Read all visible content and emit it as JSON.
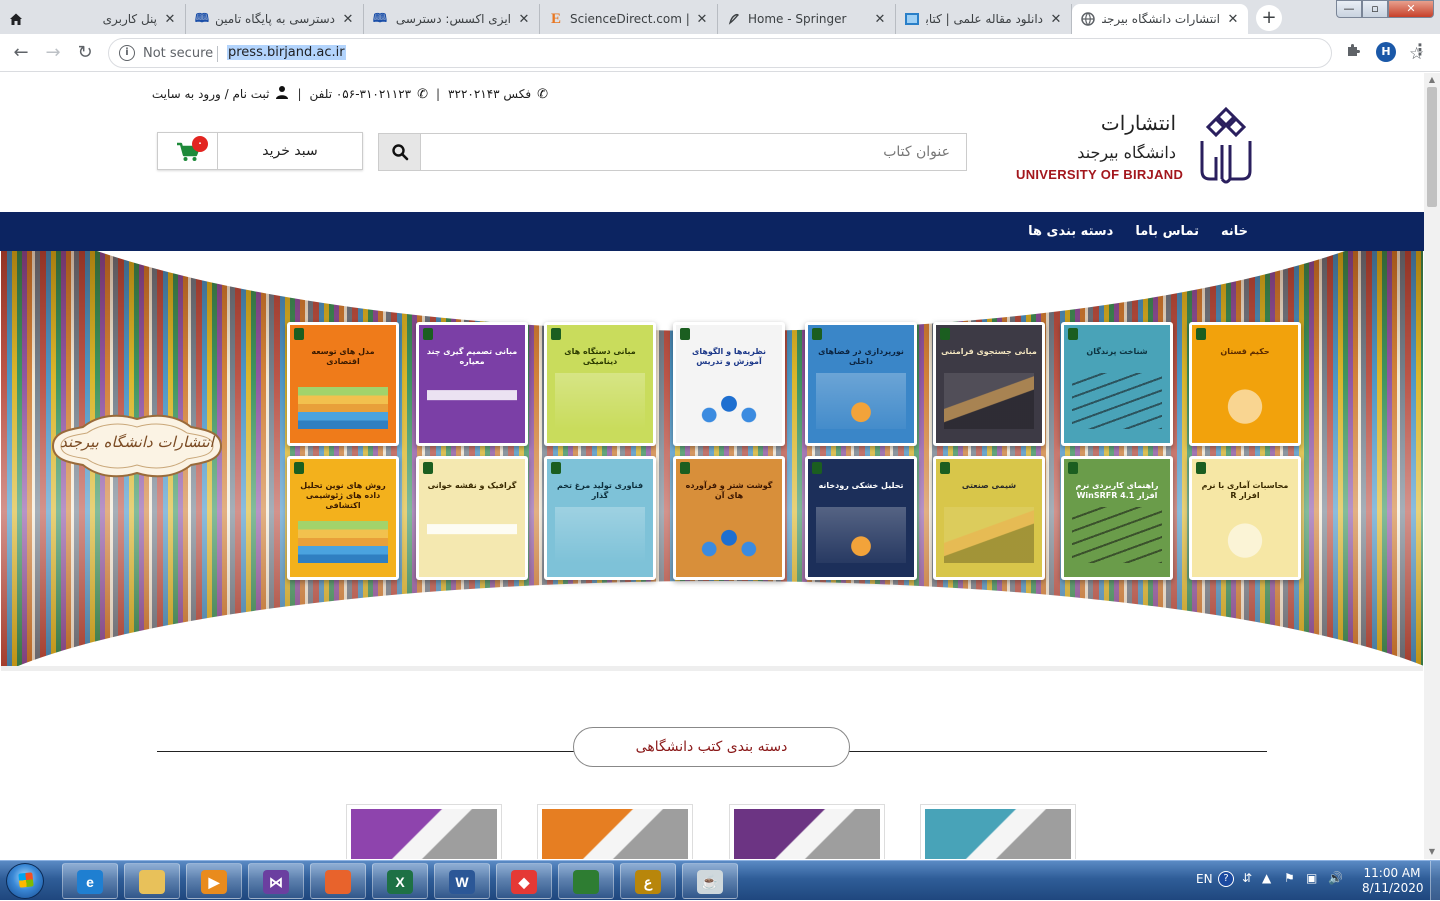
{
  "browser": {
    "tabs": [
      {
        "title": "پنل کاربری",
        "favicon": "home-icon"
      },
      {
        "title": "دسترسی به پایگاه تامین منابع",
        "favicon": "book-icon"
      },
      {
        "title": "ایزی اکسس: دسترسی مستقیم",
        "favicon": "book-icon"
      },
      {
        "title": "ScienceDirect.com | Science",
        "favicon": "elsevier-icon"
      },
      {
        "title": "Home - Springer",
        "favicon": "springer-icon"
      },
      {
        "title": "دانلود مقاله علمی | کتابخانه",
        "favicon": "page-icon"
      },
      {
        "title": "انتشارات دانشگاه بیرجند -",
        "favicon": "globe-icon"
      }
    ],
    "new_tab": "+",
    "window_controls": {
      "minimize": "—",
      "maximize": "▫",
      "close": "✕"
    },
    "nav": {
      "back": "←",
      "forward": "→",
      "reload": "↻"
    },
    "address": {
      "security": "Not secure",
      "url": "press.birjand.ac.ir"
    },
    "profile_initial": "H"
  },
  "site": {
    "contact": {
      "fax": "فکس ۳۲۲۰۲۱۴۳",
      "phone": "۰۵۶-۳۱۰۲۱۱۲۳ تلفن",
      "login": "ثبت نام / ورود به سایت"
    },
    "logo": {
      "title_fa": "انتشارات",
      "subtitle_fa": "دانشگاه بیرجند",
      "title_en": "UNIVERSITY OF BIRJAND"
    },
    "search": {
      "placeholder": "عنوان کتاب"
    },
    "cart": {
      "label": "سبد خرید",
      "count": "۰"
    },
    "nav": [
      "خانه",
      "تماس باما",
      "دسته بندی ها"
    ],
    "hero_badge": "انتشارات دانشگاه بیرجند",
    "books": [
      {
        "title": "حکیم قستان",
        "color": "#f2a20c",
        "fg": "#5a2a00"
      },
      {
        "title": "شناخت پرندگان",
        "color": "#49a3b8",
        "fg": "#0d3340"
      },
      {
        "title": "مبانی جستجوی فرامتنی",
        "color": "#3d3a45",
        "fg": "#f3e5c0"
      },
      {
        "title": "نورپردازی در فضاهای داخلی",
        "color": "#3a86c8",
        "fg": "#0b2440"
      },
      {
        "title": "نظریه‌ها و الگوهای آموزش و تدریس",
        "color": "#f4f4f4",
        "fg": "#1e3a8a"
      },
      {
        "title": "مبانی دستگاه های دینامیکی",
        "color": "#c9dc5c",
        "fg": "#2d3c00"
      },
      {
        "title": "مبانی تصمیم گیری چند معیاره",
        "color": "#7b3fa6",
        "fg": "#ffffff"
      },
      {
        "title": "مدل های توسعه اقتصادی",
        "color": "#ef7b1a",
        "fg": "#3a1a00"
      },
      {
        "title": "محاسبات آماری با نرم افزار R",
        "color": "#f6e7a5",
        "fg": "#3a2a00"
      },
      {
        "title": "راهنمای کاربردی نرم افزار WinSRFR 4.1",
        "color": "#6a9c4a",
        "fg": "#ffffff"
      },
      {
        "title": "شیمی صنعتی",
        "color": "#d8c64a",
        "fg": "#2a2a2a"
      },
      {
        "title": "تحلیل خشکی رودخانه",
        "color": "#1c2f5a",
        "fg": "#ffffff"
      },
      {
        "title": "گوشت شتر و فرآورده های آن",
        "color": "#d88f3a",
        "fg": "#3a1500"
      },
      {
        "title": "فناوری تولید مرغ تخم گذار",
        "color": "#7ec2d8",
        "fg": "#0d2f3d"
      },
      {
        "title": "گرافیک و نقشه خوانی",
        "color": "#f4e8b0",
        "fg": "#3a2a00"
      },
      {
        "title": "روش های نوین تحلیل داده های ژئوشیمی اکتشافی",
        "color": "#f3b11c",
        "fg": "#3a1a00"
      }
    ],
    "section_title": "دسته بندی کتب دانشگاهی",
    "category_thumbs": [
      {
        "color": "#8e44ad"
      },
      {
        "color": "#e67e22"
      },
      {
        "color": "#6c3483"
      },
      {
        "color": "#48a3b8"
      }
    ]
  },
  "taskbar": {
    "apps": [
      {
        "name": "internet-explorer-icon",
        "label": "e",
        "color": "#1f7fd1"
      },
      {
        "name": "file-explorer-icon",
        "label": "",
        "color": "#e8c15a"
      },
      {
        "name": "media-player-icon",
        "label": "▶",
        "color": "#e98b1d"
      },
      {
        "name": "visual-studio-icon",
        "label": "⋈",
        "color": "#6b3fa0"
      },
      {
        "name": "firefox-icon",
        "label": "",
        "color": "#e8632c"
      },
      {
        "name": "excel-icon",
        "label": "X",
        "color": "#1e7145"
      },
      {
        "name": "word-icon",
        "label": "W",
        "color": "#2b5797"
      },
      {
        "name": "anydesk-icon",
        "label": "◆",
        "color": "#e53935"
      },
      {
        "name": "chrome-icon",
        "label": "",
        "color": "#2e7d32"
      },
      {
        "name": "noor-app-icon",
        "label": "ع",
        "color": "#b8860b"
      },
      {
        "name": "java-icon",
        "label": "☕",
        "color": "#cfd8dc"
      }
    ],
    "tray": {
      "lang": "EN",
      "help": "?",
      "time": "11:00 AM",
      "date": "8/11/2020"
    }
  }
}
